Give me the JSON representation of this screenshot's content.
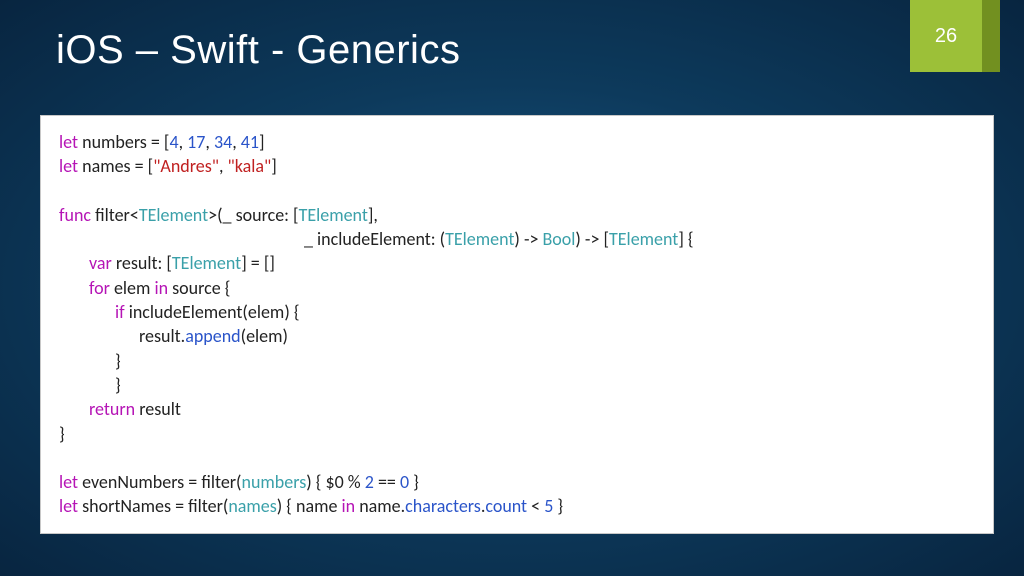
{
  "slide": {
    "title": "iOS – Swift - Generics",
    "page_number": "26"
  },
  "code": {
    "l1": {
      "let": "let",
      "sp": " ",
      "name": "numbers = [",
      "n1": "4",
      "c1": ", ",
      "n2": "17",
      "c2": ", ",
      "n3": "34",
      "c3": ", ",
      "n4": "41",
      "close": "]"
    },
    "l2": {
      "let": "let",
      "sp": " ",
      "name": "names = [",
      "s1": "\"Andres\"",
      "c": ", ",
      "s2": "\"kala\"",
      "close": "]"
    },
    "l3": {
      "func": "func",
      "sp": " ",
      "name": "filter<",
      "t": "TElement",
      "after": ">(_ source: [",
      "t2": "TElement",
      "close": "],"
    },
    "l4": {
      "pre": "_ includeElement: (",
      "t": "TElement",
      "mid": ") -> ",
      "bool": "Bool",
      "mid2": ") -> [",
      "t2": "TElement",
      "close": "] {"
    },
    "l5": {
      "var": "var",
      "sp": " ",
      "name": "result: [",
      "t": "TElement",
      "close": "] = []"
    },
    "l6": {
      "for": "for",
      "sp": " ",
      "elem": "elem ",
      "in": "in",
      "sp2": " ",
      "src": "source {"
    },
    "l7": {
      "if": "if",
      "sp": " ",
      "rest": "includeElement(elem) {"
    },
    "l8": {
      "pre": "result.",
      "fn": "append",
      "post": "(elem)"
    },
    "l9": {
      "b": "}"
    },
    "l10": {
      "b": "}"
    },
    "l11": {
      "ret": "return",
      "sp": " ",
      "r": "result"
    },
    "l12": {
      "b": "}"
    },
    "l13": {
      "let": "let",
      "sp": " ",
      "name": "evenNumbers = filter(",
      "arg": "numbers",
      "mid": ") { $0 % ",
      "n1": "2",
      "eq": " == ",
      "n2": "0",
      "close": " }"
    },
    "l14": {
      "let": "let",
      "sp": " ",
      "name": "shortNames = filter(",
      "arg": "names",
      "mid": ") { name ",
      "in": "in",
      "sp2": " ",
      "post": "name.",
      "p1": "characters",
      "dot": ".",
      "p2": "count",
      "lt": " < ",
      "n": "5",
      "close": " }"
    }
  }
}
